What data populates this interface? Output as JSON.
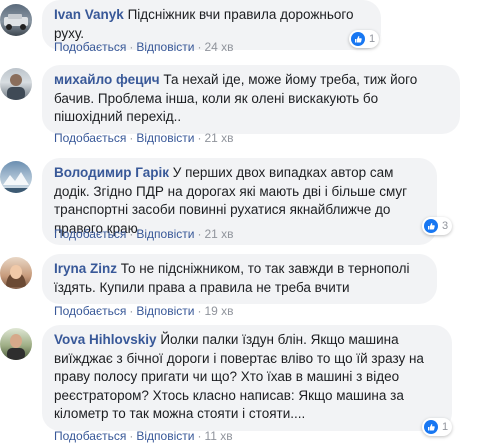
{
  "comments": [
    {
      "author": "Ivan Vanyk",
      "text": "Підсніжник вчи правила дорожнього руху.",
      "like_label": "Подобається",
      "reply_label": "Відповісти",
      "time": "24 хв",
      "reactions": "1"
    },
    {
      "author": "михайло фецич",
      "text": "Та нехай іде, може йому треба, тиж його бачив. Проблема інша, коли як олені вискакують бо пішохідний перехід..",
      "like_label": "Подобається",
      "reply_label": "Відповісти",
      "time": "21 хв"
    },
    {
      "author": "Володимир Гарік",
      "text": "У перших двох випадках автор сам додік. Згідно ПДР на дорогах які мають дві і більше смуг транспортні засоби повинні рухатися якнайближче до правого краю",
      "like_label": "Подобається",
      "reply_label": "Відповісти",
      "time": "21 хв",
      "reactions": "3"
    },
    {
      "author": "Iryna Zinz",
      "text": "То не підсніжником, то так завжди в тернополі їздять. Купили права а правила не треба вчити",
      "like_label": "Подобається",
      "reply_label": "Відповісти",
      "time": "19 хв"
    },
    {
      "author": "Vova Hihlovskiy",
      "text": "Йолки палки їздун блін. Якщо машина виїжджає з бічної дороги і повертає вліво то що їй зразу на праву полосу пригати чи що? Хто їхав в машині з відео реєстратором? Хтось класно написав: Якщо машина за кілометр то так можна стояти і стояти....",
      "like_label": "Подобається",
      "reply_label": "Відповісти",
      "time": "11 хв",
      "reactions": "1"
    }
  ],
  "colors": {
    "author": "#385898",
    "bubble": "#f2f3f5",
    "meta": "#90949c",
    "like": "#1877f2"
  },
  "icons": [
    "avatar",
    "like-icon"
  ]
}
